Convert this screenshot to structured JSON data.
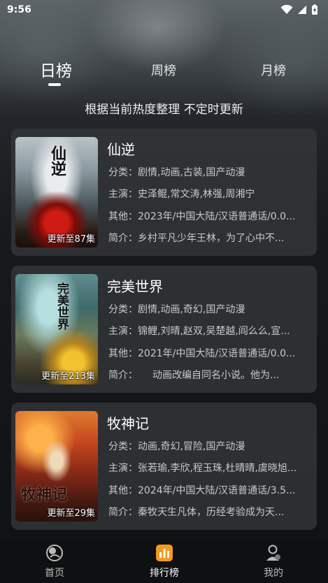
{
  "status_bar": {
    "time": "9:56"
  },
  "tabs": [
    {
      "label": "日榜",
      "active": true
    },
    {
      "label": "周榜",
      "active": false
    },
    {
      "label": "月榜",
      "active": false
    }
  ],
  "subtitle": "根据当前热度整理 不定时更新",
  "items": [
    {
      "title": "仙逆",
      "badge": "更新至87集",
      "category": "分类：剧情,动画,古装,国产动漫",
      "cast": "主演：史泽鲲,常文涛,林强,周湘宁",
      "other": "其他：2023年/中国大陆/汉语普通话/0.0...",
      "intro": "简介：乡村平凡少年王林，为了心中不...",
      "poster_calligraphy": "仙逆"
    },
    {
      "title": "完美世界",
      "badge": "更新至213集",
      "category": "分类：剧情,动画,奇幻,国产动漫",
      "cast": "主演：锦鲤,刘晴,赵双,吴楚越,阎么么,宣...",
      "other": "其他：2021年/中国大陆/汉语普通话/0.0...",
      "intro": "简介：　　动画改编自同名小说。他为...",
      "poster_calligraphy": "完美世界"
    },
    {
      "title": "牧神记",
      "badge": "更新至29集",
      "category": "分类：动画,奇幻,冒险,国产动漫",
      "cast": "主演：张若瑜,李欣,程玉珠,杜晴晴,虞晓旭...",
      "other": "其他：2024年/中国大陆/汉语普通话/3.5...",
      "intro": "简介：秦牧天生凡体，历经考验成为天...",
      "poster_calligraphy": "牧神记"
    }
  ],
  "bottom_nav": [
    {
      "label": "首页",
      "icon": "home-icon",
      "active": false
    },
    {
      "label": "排行榜",
      "icon": "ranking-icon",
      "active": true
    },
    {
      "label": "我的",
      "icon": "profile-icon",
      "active": false
    }
  ],
  "colors": {
    "accent": "#f39a1e",
    "card_bg": "#34373a"
  }
}
